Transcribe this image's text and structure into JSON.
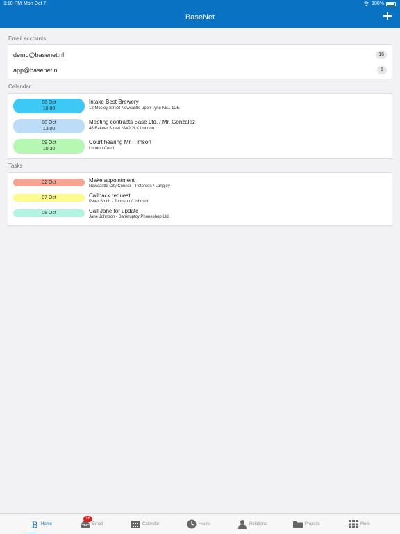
{
  "status": {
    "time": "1:10 PM",
    "date": "Mon Oct 7",
    "battery": "100%"
  },
  "header": {
    "title": "BaseNet"
  },
  "email_section": {
    "title": "Email accounts",
    "accounts": [
      {
        "address": "demo@basenet.nl",
        "count": "16"
      },
      {
        "address": "app@basenet.nl",
        "count": "1"
      }
    ]
  },
  "calendar_section": {
    "title": "Calendar",
    "events": [
      {
        "date": "08 Oct",
        "time": "10:00",
        "title": "Intake Best Brewery",
        "subtitle": "12 Mosley Street Newcastle upon Tyne NE1 1DE",
        "color": "#3ec8f6"
      },
      {
        "date": "08 Oct",
        "time": "13:00",
        "title": "Meeting contracts Base Ltd. / Mr. Gonzalez",
        "subtitle": "46 Bakeer Street NW2 2LK London",
        "color": "#bcdcf8"
      },
      {
        "date": "09 Oct",
        "time": "10:30",
        "title": "Court hearing Mr. Timson",
        "subtitle": "London Court",
        "color": "#b6f7b4"
      }
    ]
  },
  "tasks_section": {
    "title": "Tasks",
    "tasks": [
      {
        "date": "02 Oct",
        "title": "Make appointment",
        "subtitle": "Newcastle City Council - Peterson / Langley",
        "color": "#f5a494"
      },
      {
        "date": "07 Oct",
        "title": "Callback request",
        "subtitle": "Peter Smith - Johnson / Johnson",
        "color": "#fbfb8e"
      },
      {
        "date": "08 Oct",
        "title": "Call Jane for update",
        "subtitle": "Jane Johnson - Bankruptcy Phoneshop Ltd.",
        "color": "#b2f4e0"
      }
    ]
  },
  "tabbar": {
    "email_badge": "16",
    "tabs": [
      {
        "label": "Home",
        "icon": "basenet-logo-icon"
      },
      {
        "label": "Email",
        "icon": "inbox-icon"
      },
      {
        "label": "Calendar",
        "icon": "calendar-icon"
      },
      {
        "label": "Hours",
        "icon": "clock-icon"
      },
      {
        "label": "Relations",
        "icon": "person-icon"
      },
      {
        "label": "Projects",
        "icon": "folder-icon"
      },
      {
        "label": "More",
        "icon": "grid-icon"
      }
    ]
  },
  "colors": {
    "brand": "#0a72c2",
    "background": "#f2f2f4",
    "badge": "#e02020"
  }
}
